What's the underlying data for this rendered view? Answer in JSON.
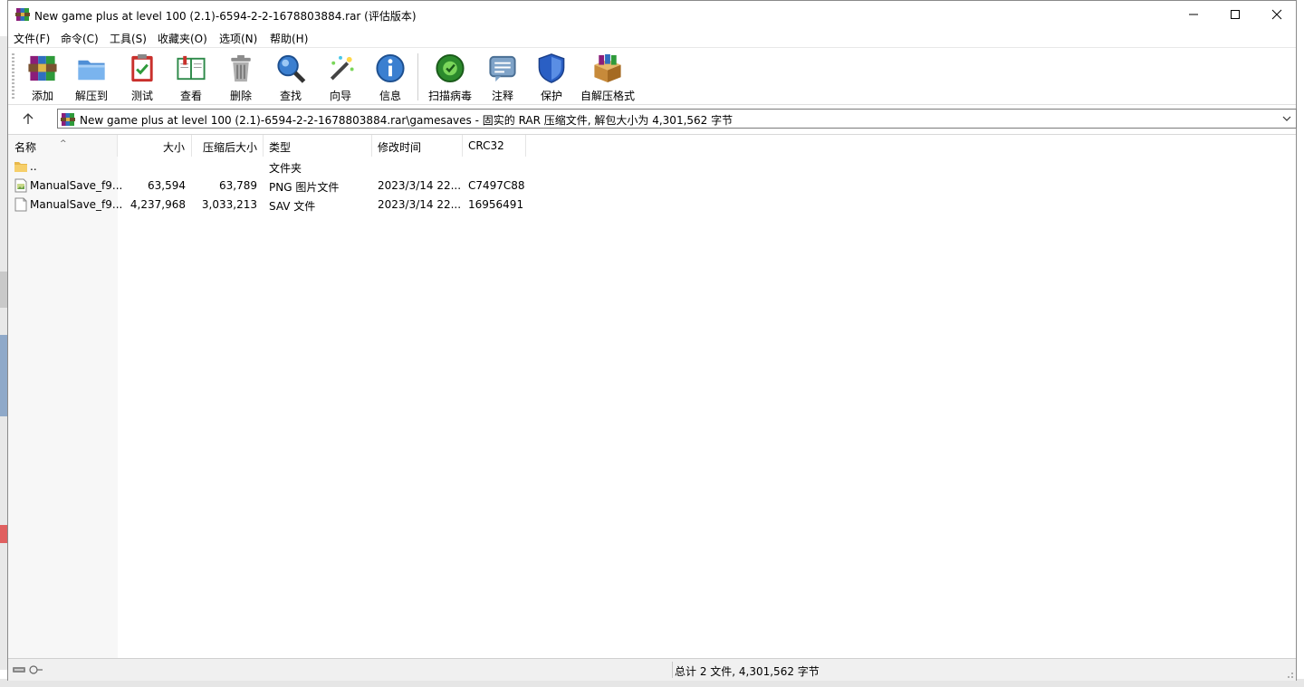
{
  "window": {
    "title": "New game plus at level 100 (2.1)-6594-2-2-1678803884.rar (评估版本)",
    "controls": {
      "minimize": "—",
      "maximize": "☐",
      "close": "✕"
    }
  },
  "menu": [
    "文件(F)",
    "命令(C)",
    "工具(S)",
    "收藏夹(O)",
    "选项(N)",
    "帮助(H)"
  ],
  "toolbar": [
    {
      "label": "添加",
      "icon": "archive-add-icon"
    },
    {
      "label": "解压到",
      "icon": "extract-folder-icon"
    },
    {
      "label": "测试",
      "icon": "test-clipboard-icon"
    },
    {
      "label": "查看",
      "icon": "view-book-icon"
    },
    {
      "label": "删除",
      "icon": "trash-icon"
    },
    {
      "label": "查找",
      "icon": "magnifier-icon"
    },
    {
      "label": "向导",
      "icon": "wizard-wand-icon"
    },
    {
      "label": "信息",
      "icon": "info-icon"
    },
    {
      "label": "扫描病毒",
      "icon": "virus-scan-icon"
    },
    {
      "label": "注释",
      "icon": "comment-icon"
    },
    {
      "label": "保护",
      "icon": "shield-icon"
    },
    {
      "label": "自解压格式",
      "icon": "sfx-box-icon"
    }
  ],
  "address": {
    "path": "New game plus at level 100 (2.1)-6594-2-2-1678803884.rar\\gamesaves - 固实的 RAR 压缩文件, 解包大小为 4,301,562 字节"
  },
  "columns": {
    "name": "名称",
    "size": "大小",
    "packed": "压缩后大小",
    "type": "类型",
    "modified": "修改时间",
    "crc": "CRC32"
  },
  "rows": [
    {
      "name": "..",
      "size": "",
      "packed": "",
      "type": "文件夹",
      "modified": "",
      "crc": "",
      "icon": "folder-icon"
    },
    {
      "name": "ManualSave_f9...",
      "size": "63,594",
      "packed": "63,789",
      "type": "PNG 图片文件",
      "modified": "2023/3/14 22...",
      "crc": "C7497C88",
      "icon": "image-file-icon"
    },
    {
      "name": "ManualSave_f9...",
      "size": "4,237,968",
      "packed": "3,033,213",
      "type": "SAV 文件",
      "modified": "2023/3/14 22...",
      "crc": "16956491",
      "icon": "blank-file-icon"
    }
  ],
  "status": {
    "summary": "总计 2 文件, 4,301,562 字节"
  }
}
